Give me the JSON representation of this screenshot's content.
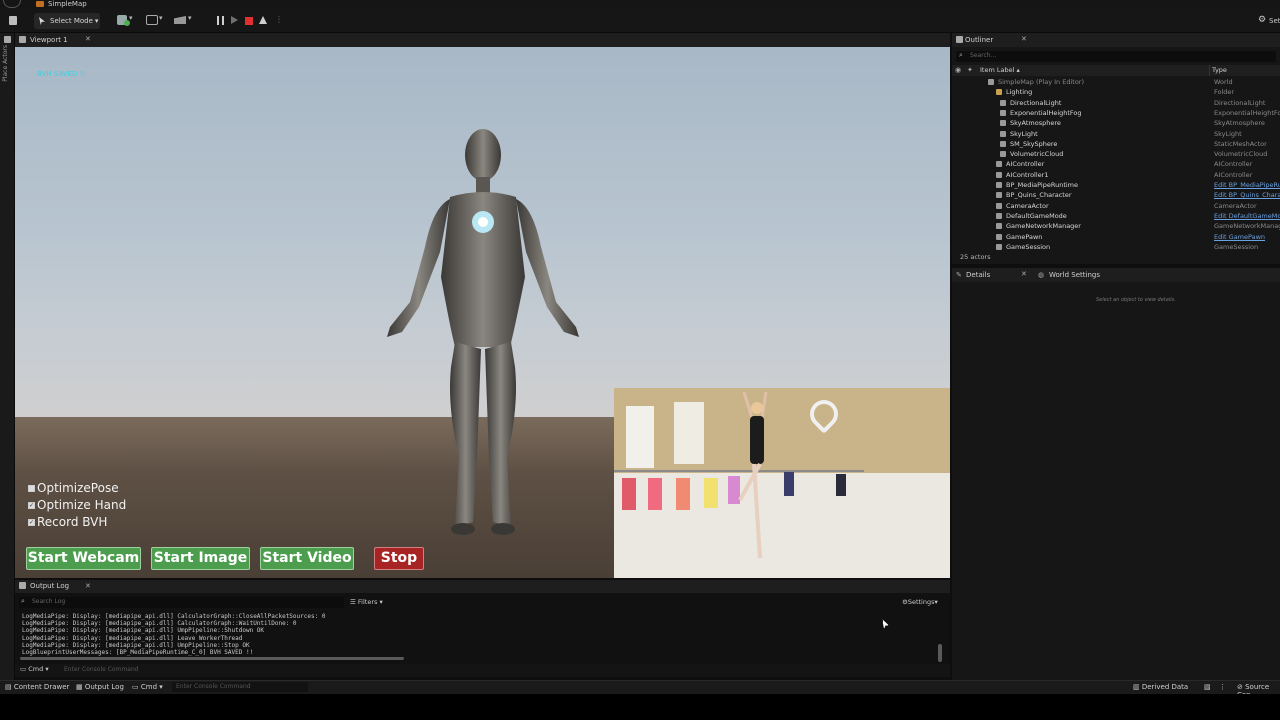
{
  "window": {
    "map_tab": "SimpleMap",
    "settings_label": "Setti"
  },
  "toolbar": {
    "select_mode": "Select Mode"
  },
  "left_panel": {
    "place_actors": "Place Actors"
  },
  "viewport": {
    "tab_label": "Viewport 1",
    "status_text": "BVH SAVED !!",
    "checkboxes": [
      {
        "label": "OptimizePose",
        "checked": false
      },
      {
        "label": "Optimize Hand",
        "checked": true
      },
      {
        "label": "Record BVH",
        "checked": true
      }
    ],
    "buttons": {
      "webcam": "Start Webcam",
      "image": "Start Image",
      "video": "Start Video",
      "stop": "Stop"
    },
    "colors": {
      "start_button": "#4c9e4e",
      "stop_button": "#a82424",
      "status_text": "#3fd0e0"
    }
  },
  "outliner": {
    "tab_label": "Outliner",
    "search_placeholder": "Search...",
    "col_label": "Item Label ▴",
    "col_type": "Type",
    "rows": [
      {
        "name": "SimpleMap (Play In Editor)",
        "type": "World",
        "indent": 0,
        "link": false
      },
      {
        "name": "Lighting",
        "type": "Folder",
        "indent": 1,
        "link": false
      },
      {
        "name": "DirectionalLight",
        "type": "DirectionalLight",
        "indent": 2,
        "link": false
      },
      {
        "name": "ExponentialHeightFog",
        "type": "ExponentialHeightFog",
        "indent": 2,
        "link": false
      },
      {
        "name": "SkyAtmosphere",
        "type": "SkyAtmosphere",
        "indent": 2,
        "link": false
      },
      {
        "name": "SkyLight",
        "type": "SkyLight",
        "indent": 2,
        "link": false
      },
      {
        "name": "SM_SkySphere",
        "type": "StaticMeshActor",
        "indent": 2,
        "link": false
      },
      {
        "name": "VolumetricCloud",
        "type": "VolumetricCloud",
        "indent": 2,
        "link": false
      },
      {
        "name": "AIController",
        "type": "AIController",
        "indent": 1,
        "link": false
      },
      {
        "name": "AIController1",
        "type": "AIController",
        "indent": 1,
        "link": false
      },
      {
        "name": "BP_MediaPipeRuntime",
        "type": "Edit BP_MediaPipeRu",
        "indent": 1,
        "link": true
      },
      {
        "name": "BP_Quins_Character",
        "type": "Edit BP_Quins_Chara",
        "indent": 1,
        "link": true
      },
      {
        "name": "CameraActor",
        "type": "CameraActor",
        "indent": 1,
        "link": false
      },
      {
        "name": "DefaultGameMode",
        "type": "Edit DefaultGameMo",
        "indent": 1,
        "link": true
      },
      {
        "name": "GameNetworkManager",
        "type": "GameNetworkManage",
        "indent": 1,
        "link": false
      },
      {
        "name": "GamePawn",
        "type": "Edit GamePawn",
        "indent": 1,
        "link": true
      },
      {
        "name": "GameSession",
        "type": "GameSession",
        "indent": 1,
        "link": false
      }
    ],
    "actor_count": "25 actors"
  },
  "details": {
    "tab_label": "Details",
    "world_settings_tab": "World Settings",
    "empty_hint": "Select an object to view details."
  },
  "output_log": {
    "tab_label": "Output Log",
    "search_placeholder": "Search Log",
    "filters_label": "Filters",
    "settings_label": "Settings",
    "lines": [
      "LogMediaPipe: Display: [mediapipe_api.dll] CalculatorGraph::CloseAllPacketSources: 0",
      "LogMediaPipe: Display: [mediapipe_api.dll] CalculatorGraph::WaitUntilDone: 0",
      "LogMediaPipe: Display: [mediapipe_api.dll] UmpPipeline::Shutdown OK",
      "LogMediaPipe: Display: [mediapipe_api.dll] Leave WorkerThread",
      "LogMediaPipe: Display: [mediapipe_api.dll] UmpPipeline::Stop OK",
      "LogBlueprintUserMessages: [BP_MediaPipeRuntime_C_0] BVH SAVED !!"
    ],
    "cmd_label": "Cmd",
    "cmd_placeholder": "Enter Console Command"
  },
  "statusbar": {
    "content_drawer": "Content Drawer",
    "output_log": "Output Log",
    "cmd": "Cmd",
    "cmd_placeholder": "Enter Console Command",
    "derived_data": "Derived Data",
    "source_control": "Source Con"
  }
}
